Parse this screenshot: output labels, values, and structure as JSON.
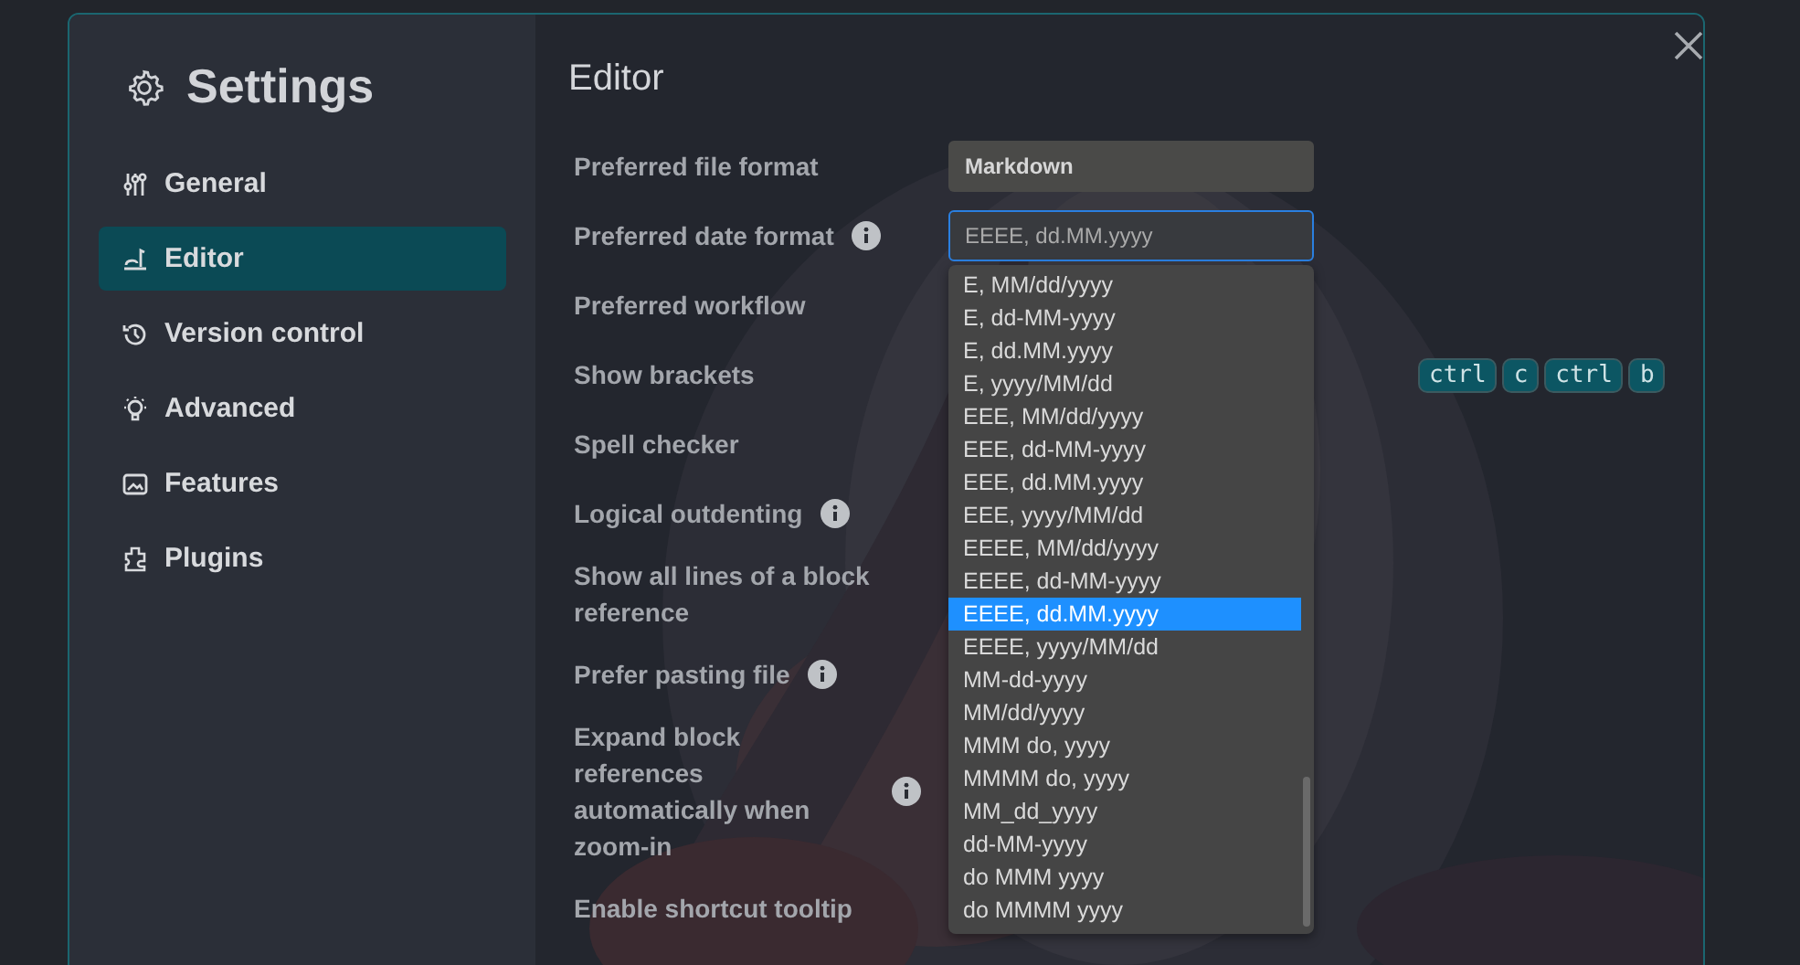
{
  "sidebar": {
    "title": "Settings",
    "items": [
      {
        "label": "General",
        "selected": false
      },
      {
        "label": "Editor",
        "selected": true
      },
      {
        "label": "Version control",
        "selected": false
      },
      {
        "label": "Advanced",
        "selected": false
      },
      {
        "label": "Features",
        "selected": false
      },
      {
        "label": "Plugins",
        "selected": false
      }
    ]
  },
  "content": {
    "heading": "Editor",
    "rows": [
      {
        "label": "Preferred file format",
        "info": false,
        "kind": "select",
        "value": "Markdown",
        "focused": false
      },
      {
        "label": "Preferred date format",
        "info": true,
        "kind": "select",
        "value": "EEEE, dd.MM.yyyy",
        "focused": true,
        "options": [
          {
            "label": "E, MM/dd/yyyy",
            "selected": false
          },
          {
            "label": "E, dd-MM-yyyy",
            "selected": false
          },
          {
            "label": "E, dd.MM.yyyy",
            "selected": false
          },
          {
            "label": "E, yyyy/MM/dd",
            "selected": false
          },
          {
            "label": "EEE, MM/dd/yyyy",
            "selected": false
          },
          {
            "label": "EEE, dd-MM-yyyy",
            "selected": false
          },
          {
            "label": "EEE, dd.MM.yyyy",
            "selected": false
          },
          {
            "label": "EEE, yyyy/MM/dd",
            "selected": false
          },
          {
            "label": "EEEE, MM/dd/yyyy",
            "selected": false
          },
          {
            "label": "EEEE, dd-MM-yyyy",
            "selected": false
          },
          {
            "label": "EEEE, dd.MM.yyyy",
            "selected": true
          },
          {
            "label": "EEEE, yyyy/MM/dd",
            "selected": false
          },
          {
            "label": "MM-dd-yyyy",
            "selected": false
          },
          {
            "label": "MM/dd/yyyy",
            "selected": false
          },
          {
            "label": "MMM do, yyyy",
            "selected": false
          },
          {
            "label": "MMMM do, yyyy",
            "selected": false
          },
          {
            "label": "MM_dd_yyyy",
            "selected": false
          },
          {
            "label": "dd-MM-yyyy",
            "selected": false
          },
          {
            "label": "do MMM yyyy",
            "selected": false
          },
          {
            "label": "do MMMM yyyy",
            "selected": false
          }
        ]
      },
      {
        "label": "Preferred workflow",
        "info": false
      },
      {
        "label": "Show brackets",
        "info": false,
        "kind": "shortcut",
        "keys": [
          "ctrl",
          "c",
          "ctrl",
          "b"
        ]
      },
      {
        "label": "Spell checker",
        "info": false
      },
      {
        "label": "Logical outdenting",
        "info": true
      },
      {
        "label": "Show all lines of a block reference",
        "info": false
      },
      {
        "label": "Prefer pasting file",
        "info": true
      },
      {
        "label": "Expand block references automatically when zoom-in",
        "info": true
      },
      {
        "label": "Enable shortcut tooltip",
        "info": false
      }
    ]
  }
}
